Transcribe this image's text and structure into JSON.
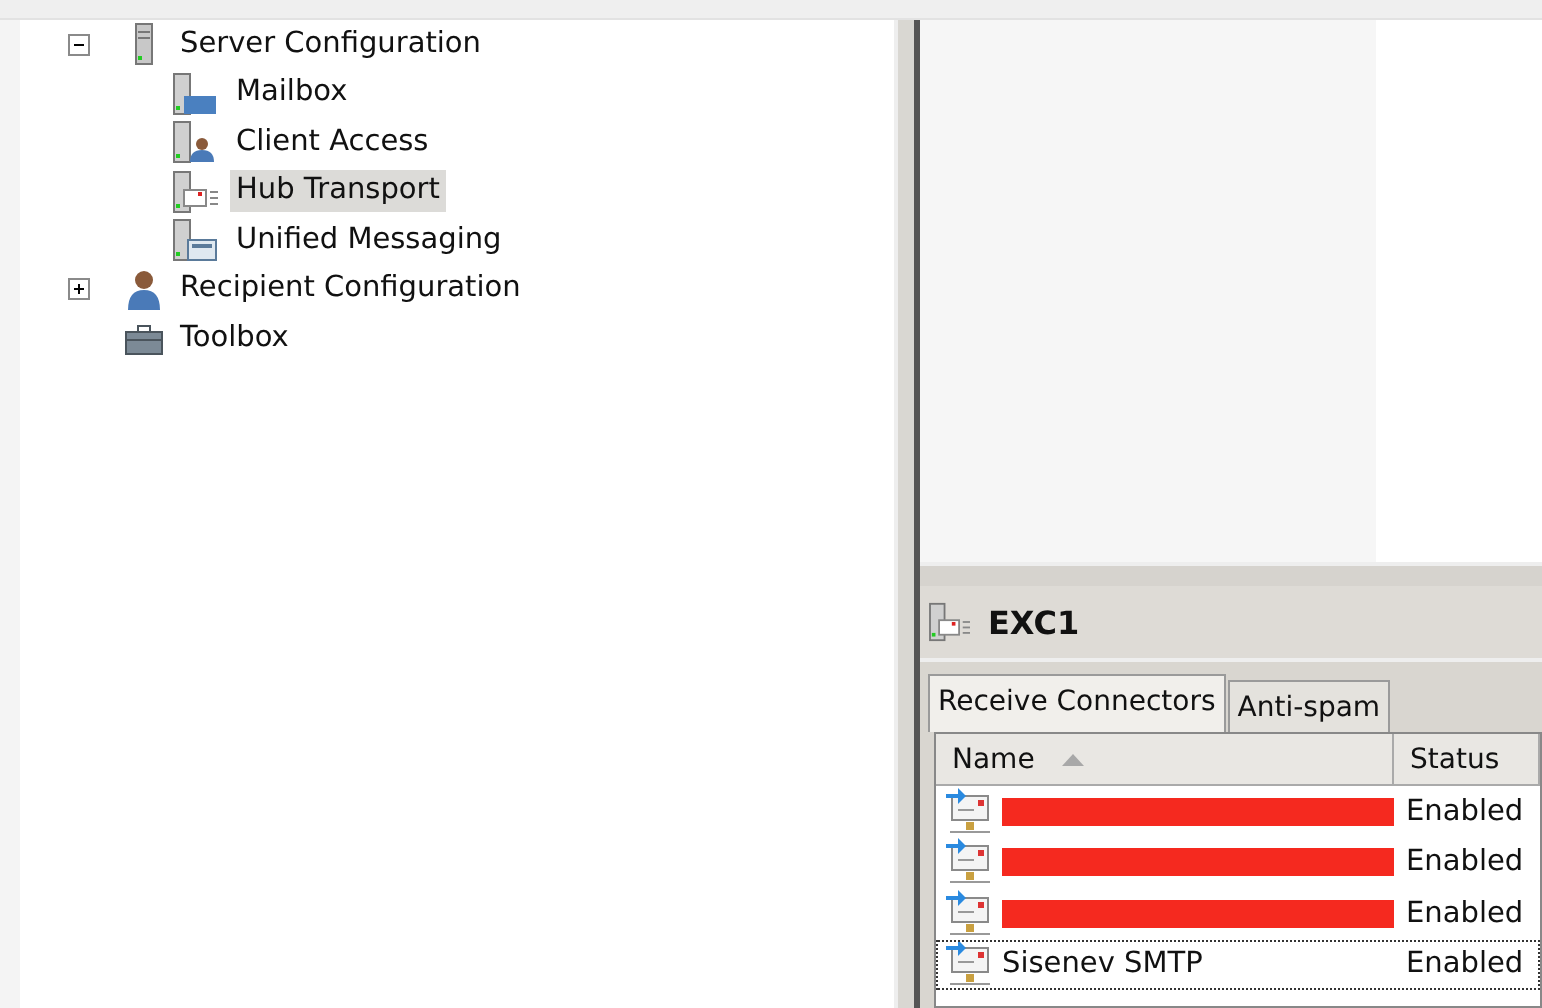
{
  "tree": [
    {
      "label": "Server Configuration",
      "kind": "server",
      "expanded": true,
      "selected": false,
      "children": [
        {
          "label": "Mailbox",
          "kind": "mailbox",
          "selected": false
        },
        {
          "label": "Client Access",
          "kind": "client",
          "selected": false
        },
        {
          "label": "Hub Transport",
          "kind": "hub",
          "selected": true
        },
        {
          "label": "Unified Messaging",
          "kind": "um",
          "selected": false
        }
      ]
    },
    {
      "label": "Recipient Configuration",
      "kind": "person",
      "expanded": false,
      "selected": false
    },
    {
      "label": "Toolbox",
      "kind": "toolbox",
      "selected": false
    }
  ],
  "detail": {
    "title": "EXC1",
    "tabs": [
      {
        "label": "Receive Connectors",
        "selected": true
      },
      {
        "label": "Anti-spam",
        "selected": false
      }
    ],
    "columns": [
      {
        "label": "Name",
        "sorted": true
      },
      {
        "label": "Status",
        "sorted": false
      }
    ],
    "rows": [
      {
        "redacted": true,
        "status": "Enabled",
        "focused": false
      },
      {
        "redacted": true,
        "status": "Enabled",
        "focused": false
      },
      {
        "redacted": true,
        "status": "Enabled",
        "focused": false
      },
      {
        "redacted": false,
        "name": "Sisenev SMTP",
        "status": "Enabled",
        "focused": true
      }
    ]
  }
}
